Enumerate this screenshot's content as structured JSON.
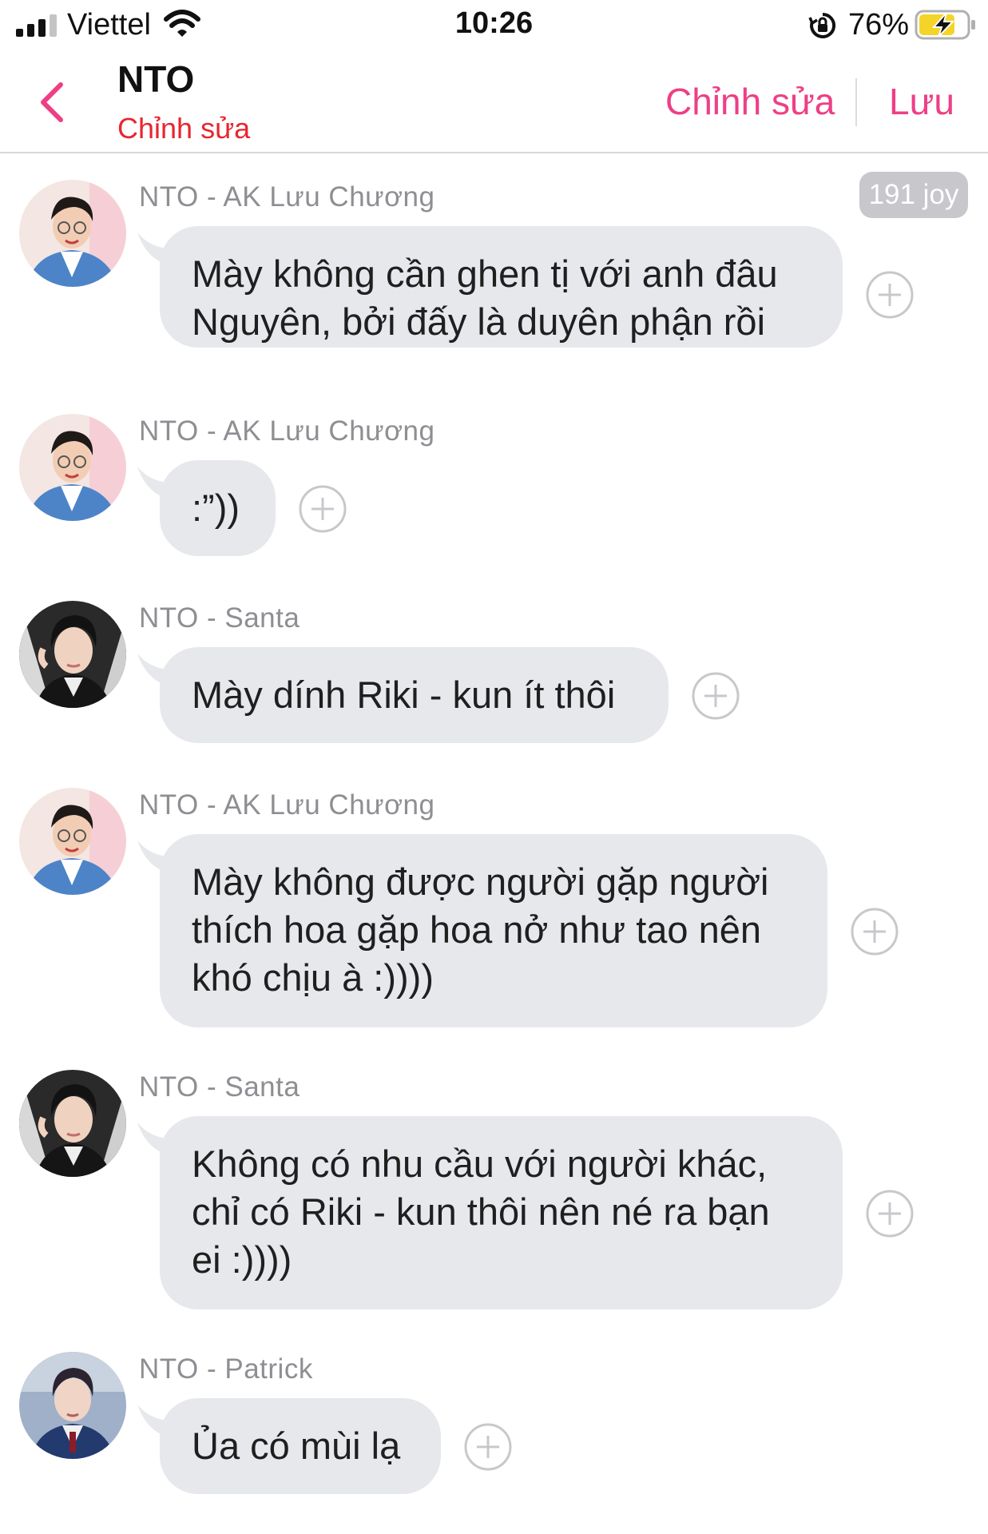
{
  "status_bar": {
    "carrier": "Viettel",
    "time": "10:26",
    "battery_percent": "76%",
    "battery_level": 0.76,
    "charging": true
  },
  "header": {
    "title": "NTO",
    "subtitle": "Chỉnh sửa",
    "edit_label": "Chỉnh sửa",
    "save_label": "Lưu"
  },
  "badge": {
    "label": "191 joy"
  },
  "colors": {
    "accent": "#ee3f85",
    "subtitle_red": "#e8262f",
    "bubble": "#e6e8ec",
    "sender_gray": "#8e8e93"
  },
  "messages": [
    {
      "sender": "NTO - AK Lưu Chương",
      "avatar": "avatar-ak",
      "lines": [
        "Mày không cần ghen tị với anh đâu",
        "Nguyên, bởi đấy là duyên phận rồi"
      ]
    },
    {
      "sender": "NTO - AK Lưu Chương",
      "avatar": "avatar-ak",
      "lines": [
        ":”))"
      ]
    },
    {
      "sender": "NTO - Santa",
      "avatar": "avatar-santa",
      "lines": [
        "Mày dính Riki - kun ít thôi"
      ]
    },
    {
      "sender": "NTO - AK Lưu Chương",
      "avatar": "avatar-ak",
      "lines": [
        "Mày không được người gặp người",
        "thích hoa gặp hoa nở như tao nên",
        "khó chịu à :))))"
      ]
    },
    {
      "sender": "NTO - Santa",
      "avatar": "avatar-santa",
      "lines": [
        "Không có nhu cầu với người khác,",
        "chỉ có Riki - kun thôi nên né ra bạn",
        "ei :))))"
      ]
    },
    {
      "sender": "NTO - Patrick",
      "avatar": "avatar-patrick",
      "lines": [
        "Ủa có mùi lạ"
      ]
    }
  ]
}
